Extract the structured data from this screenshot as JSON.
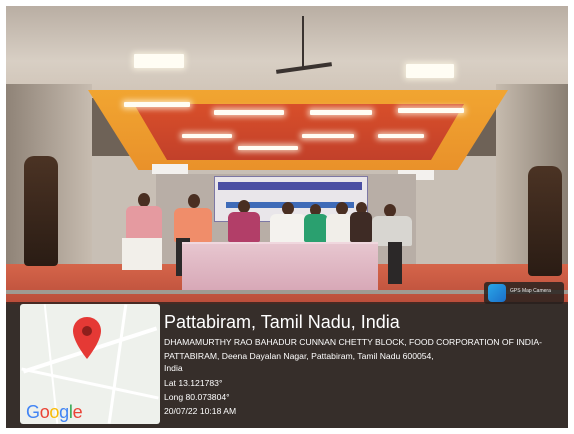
{
  "location": {
    "title": "Pattabiram, Tamil Nadu, India",
    "address": "DHAMAMURTHY RAO BAHADUR CUNNAN CHETTY BLOCK, FOOD CORPORATION OF INDIA-PATTABIRAM, Deena Dayalan Nagar, Pattabiram, Tamil Nadu 600054,",
    "country": "India",
    "latitude": "Lat 13.121783°",
    "longitude": "Long 80.073804°",
    "datetime": "20/07/22 10:18 AM"
  },
  "map": {
    "logo_parts": [
      "G",
      "o",
      "o",
      "g",
      "l",
      "e"
    ],
    "logo_colors": [
      "#4285F4",
      "#EA4335",
      "#FBBC05",
      "#4285F4",
      "#34A853",
      "#EA4335"
    ],
    "pin_color": "#E53935",
    "pin_icon": "map-pin-icon"
  },
  "camera_badge": {
    "label": "GPS Map Camera",
    "icon": "camera-app-icon"
  }
}
